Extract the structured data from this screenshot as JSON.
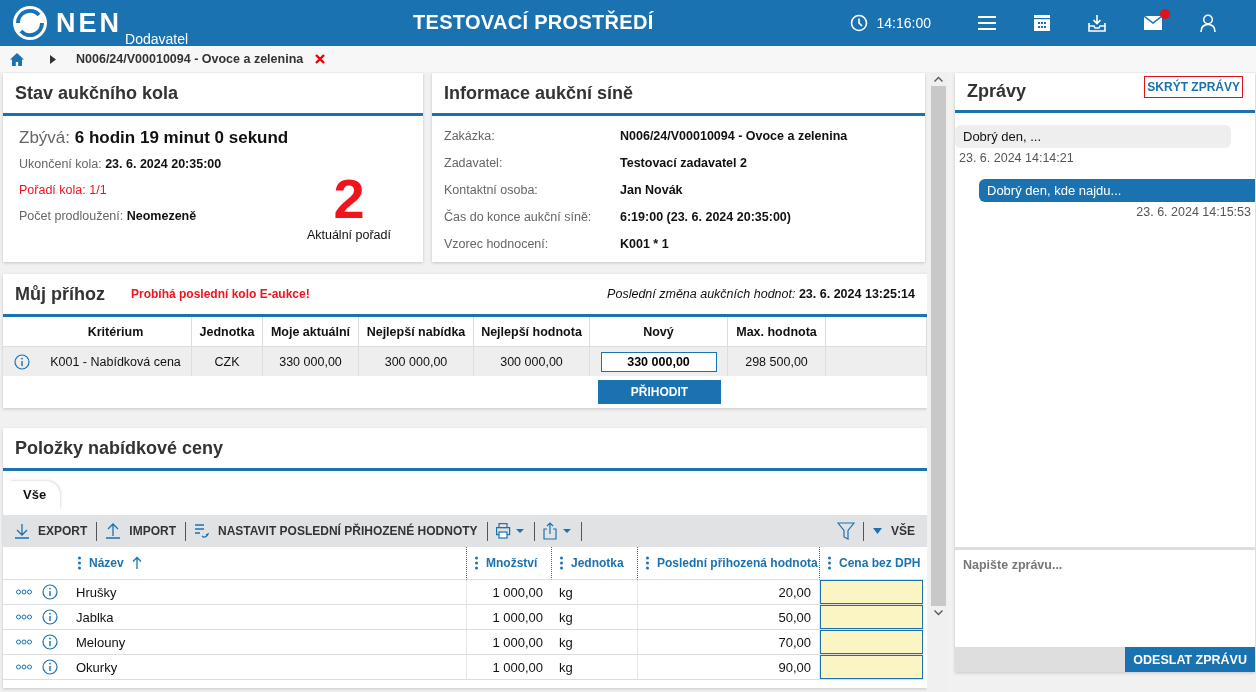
{
  "header": {
    "logo": "NEN",
    "subtitle": "Dodavatel",
    "environment": "TESTOVACÍ PROSTŘEDÍ",
    "time": "14:16:00",
    "mail_unread": true
  },
  "breadcrumb": {
    "path": "N006/24/V00010094 - Ovoce a zelenina"
  },
  "round_status": {
    "title": "Stav aukčního kola",
    "remaining_label": "Zbývá:",
    "remaining_value": "6 hodin 19 minut 0 sekund",
    "fields": [
      {
        "label": "Ukončení kola:",
        "value": "23. 6. 2024 20:35:00",
        "alert": false
      },
      {
        "label": "Pořadí kola:",
        "value": "1/1",
        "alert": true
      },
      {
        "label": "Počet prodloužení:",
        "value": "Neomezeně",
        "alert": false
      }
    ],
    "rank": "2",
    "rank_label": "Aktuální pořadí"
  },
  "auction_info": {
    "title": "Informace aukční síně",
    "rows": [
      {
        "label": "Zakázka:",
        "value": "N006/24/V00010094 - Ovoce a zelenina"
      },
      {
        "label": "Zadavatel:",
        "value": "Testovací zadavatel 2"
      },
      {
        "label": "Kontaktní osoba:",
        "value": "Jan Novák"
      },
      {
        "label": "Čas do konce aukční síně:",
        "value": "6:19:00 (23. 6. 2024 20:35:00)"
      },
      {
        "label": "Vzorec hodnocení:",
        "value": "K001 * 1"
      }
    ]
  },
  "my_bid": {
    "title": "Můj příhoz",
    "notice": "Probíhá poslední kolo E-aukce!",
    "last_change_label": "Poslední změna aukčních hodnot:",
    "last_change_value": "23. 6. 2024 13:25:14",
    "columns": [
      "Kritérium",
      "Jednotka",
      "Moje aktuální",
      "Nejlepší nabídka",
      "Nejlepší hodnota",
      "Nový",
      "Max. hodnota"
    ],
    "row": {
      "criterion": "K001 - Nabídková cena",
      "unit": "CZK",
      "my_current": "330 000,00",
      "best_offer": "300 000,00",
      "best_value": "300 000,00",
      "new_value": "330 000,00",
      "max_value": "298 500,00"
    },
    "button": "PŘIHODIT"
  },
  "items": {
    "title": "Položky nabídkové ceny",
    "tabs": [
      {
        "label": "Vše",
        "selected": true
      }
    ],
    "toolbar": [
      "EXPORT",
      "IMPORT",
      "NASTAVIT POSLEDNÍ PŘIHOZENÉ HODNOTY"
    ],
    "filter_label": "VŠE",
    "columns": [
      {
        "label": "Název",
        "sorted": true
      },
      {
        "label": "Množství",
        "sorted": false
      },
      {
        "label": "Jednotka",
        "sorted": false
      },
      {
        "label": "Poslední přihozená hodnota",
        "sorted": false
      },
      {
        "label": "Cena bez DPH",
        "sorted": false
      }
    ],
    "rows": [
      {
        "name": "Hrušky",
        "quantity": "1 000,00",
        "unit": "kg",
        "last_bid": "20,00"
      },
      {
        "name": "Jablka",
        "quantity": "1 000,00",
        "unit": "kg",
        "last_bid": "50,00"
      },
      {
        "name": "Melouny",
        "quantity": "1 000,00",
        "unit": "kg",
        "last_bid": "70,00"
      },
      {
        "name": "Okurky",
        "quantity": "1 000,00",
        "unit": "kg",
        "last_bid": "90,00"
      }
    ]
  },
  "messages": {
    "title": "Zprávy",
    "hide_button": "SKRÝT ZPRÁVY",
    "list": [
      {
        "text": "Dobrý den, ...",
        "time": "23. 6. 2024 14:14:21",
        "outgoing": false
      },
      {
        "text": "Dobrý den, kde najdu...",
        "time": "23. 6. 2024 14:15:53",
        "outgoing": true
      }
    ],
    "input": {
      "placeholder": "Napište zprávu..."
    },
    "send_button": "ODESLAT ZPRÁVU"
  }
}
